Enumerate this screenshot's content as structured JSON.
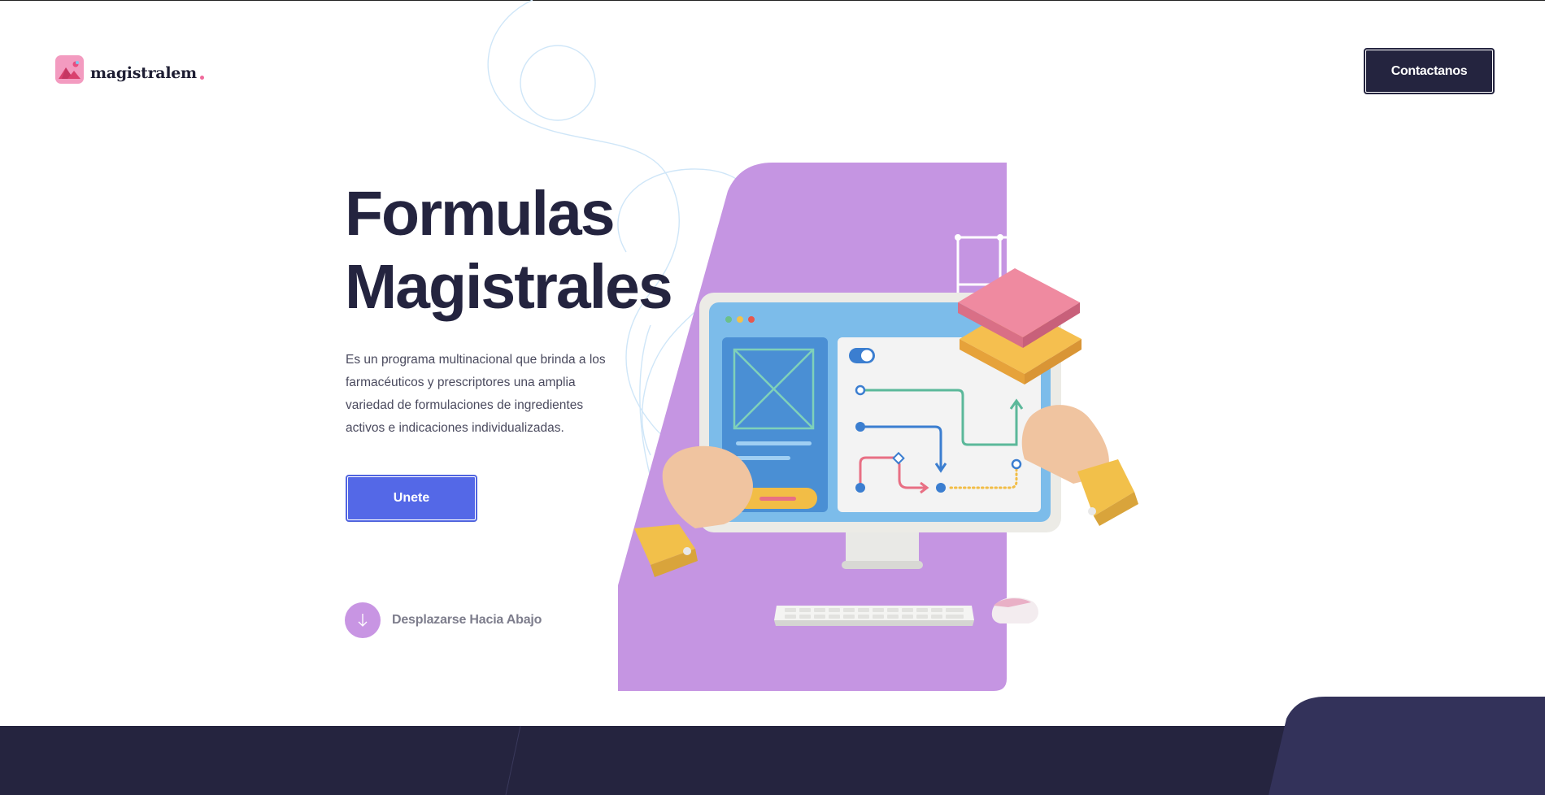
{
  "brand": {
    "name": "magistralem",
    "accent": "#f06a9b",
    "logo_color": "#f39bc0"
  },
  "header": {
    "contact_label": "Contactanos"
  },
  "hero": {
    "title_line1": "Formulas",
    "title_line2": "Magistrales",
    "description": "Es un programa multinacional que brinda a los farmacéuticos y prescriptores una amplia variedad de formulaciones de ingredientes activos e indicaciones individualizadas.",
    "join_label": "Unete",
    "scroll_label": "Desplazarse Hacia Abajo"
  },
  "colors": {
    "dark": "#24243f",
    "primary_button": "#5468e7",
    "illustration_bg": "#c595e2",
    "scroll_circle": "#c895e3",
    "decor_lines": "#cfe6f8"
  },
  "icons": {
    "scroll": "arrow-down-icon",
    "logo": "mountain-image-icon"
  }
}
